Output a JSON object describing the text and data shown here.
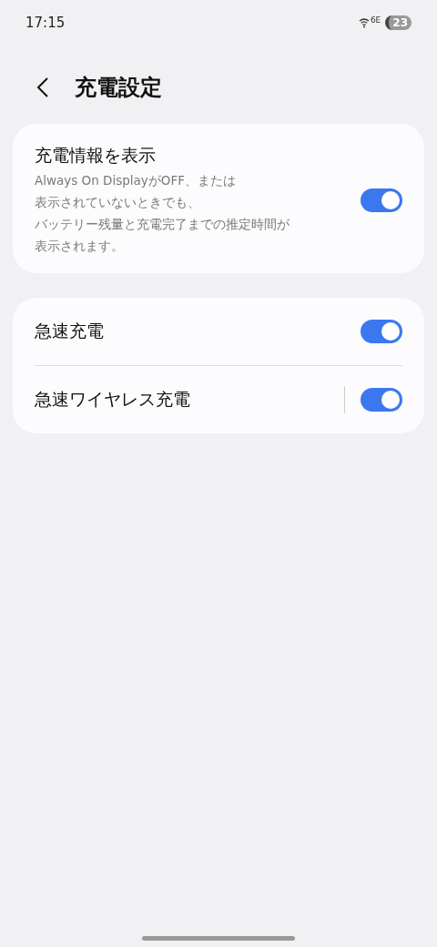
{
  "status_bar": {
    "time": "17:15",
    "network": "6E",
    "battery": "23"
  },
  "header": {
    "title": "充電設定"
  },
  "groups": [
    {
      "items": [
        {
          "label": "充電情報を表示",
          "description_lines": [
            "Always On DisplayがOFF、または",
            "表示されていないときでも、",
            "バッテリー残量と充電完了までの推定時間が",
            "表示されます。"
          ],
          "on": true,
          "separator": false
        }
      ]
    },
    {
      "items": [
        {
          "label": "急速充電",
          "on": true,
          "separator": false
        },
        {
          "label": "急速ワイヤレス充電",
          "on": true,
          "separator": true
        }
      ]
    }
  ]
}
